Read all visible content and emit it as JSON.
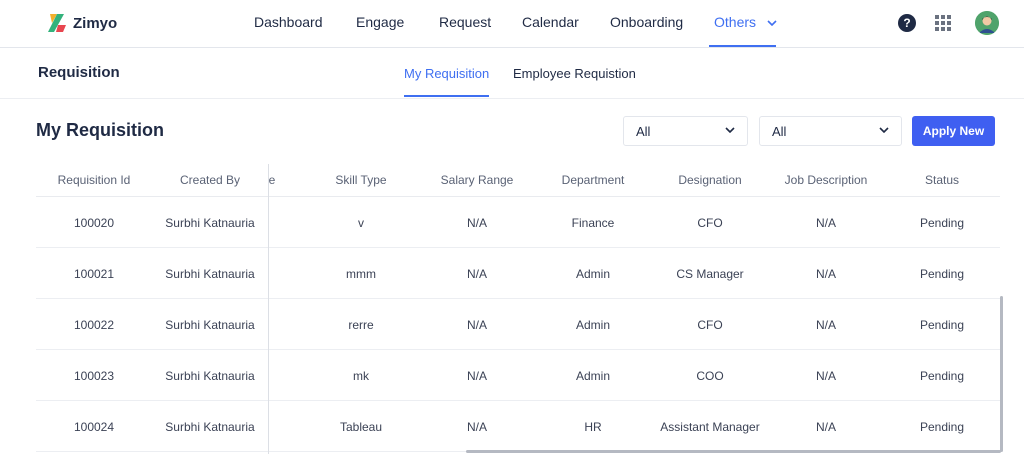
{
  "brand": {
    "name": "Zimyo"
  },
  "nav": {
    "items": [
      {
        "label": "Dashboard"
      },
      {
        "label": "Engage"
      },
      {
        "label": "Request"
      },
      {
        "label": "Calendar"
      },
      {
        "label": "Onboarding"
      },
      {
        "label": "Others"
      }
    ],
    "active": "Others",
    "help_glyph": "?",
    "icons": [
      "help-icon",
      "apps-grid-icon",
      "avatar"
    ]
  },
  "subbar": {
    "title": "Requisition",
    "tabs": [
      {
        "label": "My Requisition"
      },
      {
        "label": "Employee Requistion"
      }
    ],
    "active": "My Requisition"
  },
  "main": {
    "heading": "My Requisition",
    "filter1": {
      "value": "All"
    },
    "filter2": {
      "value": "All"
    },
    "apply_label": "Apply New"
  },
  "table": {
    "columns": [
      "Requisition Id",
      "Created By",
      "e",
      "Skill Type",
      "Salary Range",
      "Department",
      "Designation",
      "Job Description",
      "Status"
    ],
    "rows": [
      [
        "100020",
        "Surbhi Katnauria",
        "v",
        "N/A",
        "Finance",
        "CFO",
        "N/A",
        "Pending"
      ],
      [
        "100021",
        "Surbhi Katnauria",
        "mmm",
        "N/A",
        "Admin",
        "CS Manager",
        "N/A",
        "Pending"
      ],
      [
        "100022",
        "Surbhi Katnauria",
        "rerre",
        "N/A",
        "Admin",
        "CFO",
        "N/A",
        "Pending"
      ],
      [
        "100023",
        "Surbhi Katnauria",
        "mk",
        "N/A",
        "Admin",
        "COO",
        "N/A",
        "Pending"
      ],
      [
        "100024",
        "Surbhi Katnauria",
        "Tableau",
        "N/A",
        "HR",
        "Assistant Manager",
        "N/A",
        "Pending"
      ]
    ]
  },
  "colors": {
    "accent": "#3f6ff1",
    "button": "#3f5ff1",
    "text": "#1f2a44"
  }
}
